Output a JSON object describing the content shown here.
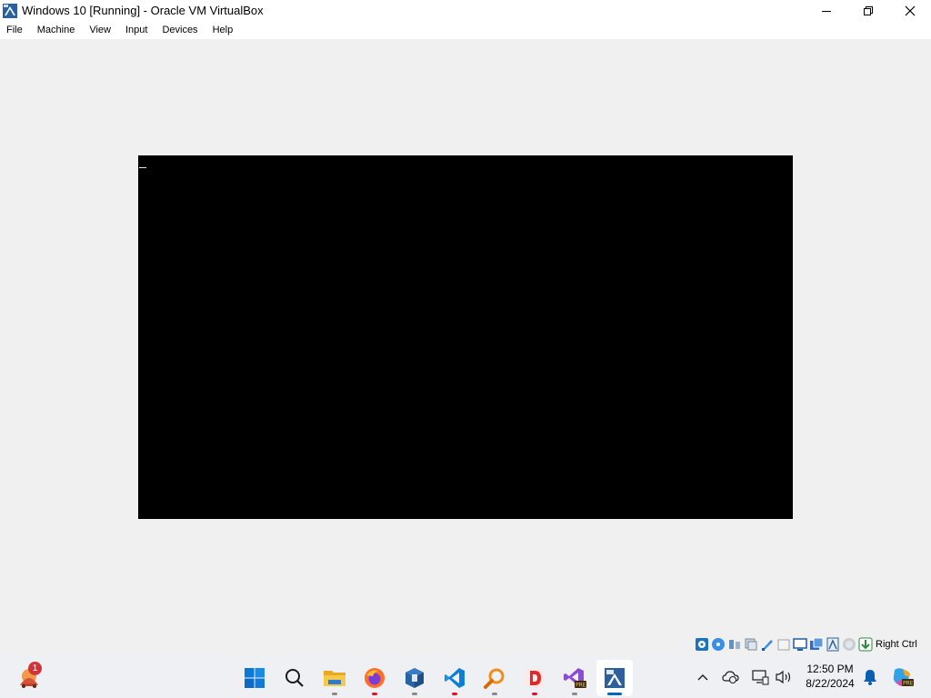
{
  "window": {
    "title": "Windows 10 [Running] - Oracle VM VirtualBox",
    "controls": [
      "minimize",
      "maximize",
      "close"
    ]
  },
  "menu": {
    "items": [
      "File",
      "Machine",
      "View",
      "Input",
      "Devices",
      "Help"
    ]
  },
  "vm": {
    "screen_color": "#000000",
    "cursor": "_"
  },
  "status_bar": {
    "icons": [
      "hard-disk-icon",
      "optical-drive-icon",
      "audio-icon",
      "network-icon",
      "usb-icon",
      "shared-folders-icon",
      "display-icon",
      "video-capture-icon",
      "cpu-icon",
      "mouse-integration-icon",
      "keyboard-capture-icon"
    ],
    "host_key": "Right Ctrl"
  },
  "taskbar": {
    "weather_badge": "1",
    "apps": [
      {
        "name": "start-button",
        "icon": "windows-logo-icon"
      },
      {
        "name": "search-button",
        "icon": "search-icon"
      },
      {
        "name": "file-explorer",
        "icon": "folder-icon"
      },
      {
        "name": "firefox",
        "icon": "firefox-icon"
      },
      {
        "name": "virtualbox",
        "icon": "virtualbox-icon"
      },
      {
        "name": "vscode",
        "icon": "vscode-icon"
      },
      {
        "name": "search-tool",
        "icon": "magnifier-app-icon"
      },
      {
        "name": "d-app",
        "icon": "d-app-icon"
      },
      {
        "name": "visual-studio-preview",
        "icon": "visual-studio-icon"
      },
      {
        "name": "virtualbox-vm",
        "icon": "virtualbox-vm-icon"
      }
    ],
    "tray": {
      "icons": [
        "chevron-up-icon",
        "onedrive-sync-icon",
        "display-settings-icon",
        "volume-icon"
      ],
      "time": "12:50 PM",
      "date": "8/22/2024",
      "notification_icon": "bell-icon",
      "copilot_icon": "copilot-icon",
      "copilot_badge": "PRE"
    }
  },
  "colors": {
    "background": "#f0f0f0",
    "titlebar": "#ffffff",
    "taskbar": "#eef0f3",
    "accent": "#0067c0",
    "running_indicator": "#e81123"
  }
}
